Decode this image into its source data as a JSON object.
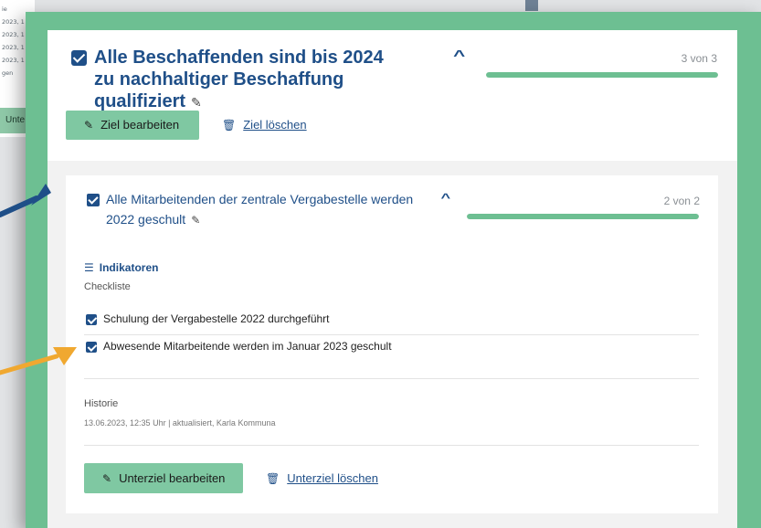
{
  "background_page": {
    "sidebar_fragments": [
      "ie",
      "2023, 1",
      "2023, 1",
      "2023, 1",
      "2023, 1",
      "gen"
    ],
    "button_fragment": "Unte"
  },
  "goal": {
    "title": "Alle Beschaffenden sind bis 2024 zu nachhaltiger Beschaffung qualifiziert",
    "progress_text": "3 von 3",
    "progress_fraction": 1.0,
    "edit_label": "Ziel bearbeiten",
    "delete_label": "Ziel löschen"
  },
  "subgoal": {
    "title": "Alle Mitarbeitenden der zentrale Vergabestelle werden 2022 geschult",
    "progress_text": "2 von 2",
    "progress_fraction": 1.0,
    "indicators_label": "Indikatoren",
    "indicator_type": "Checkliste",
    "checklist": [
      {
        "label": "Schulung der Vergabestelle 2022 durchgeführt",
        "checked": true
      },
      {
        "label": "Abwesende Mitarbeitende werden im Januar 2023 geschult",
        "checked": true
      }
    ],
    "history_label": "Historie",
    "history_entry": "13.06.2023, 12:35 Uhr | aktualisiert, Karla Kommuna",
    "edit_label": "Unterziel bearbeiten",
    "delete_label": "Unterziel löschen"
  },
  "colors": {
    "frame": "#6dbf92",
    "primary": "#1f4f88",
    "button": "#7fc8a2",
    "arrow_blue": "#1f4f88",
    "arrow_orange": "#f0a830"
  },
  "icons": [
    "checkbox-checked-icon",
    "chevron-up-icon",
    "pencil-icon",
    "trash-icon",
    "sliders-icon"
  ]
}
